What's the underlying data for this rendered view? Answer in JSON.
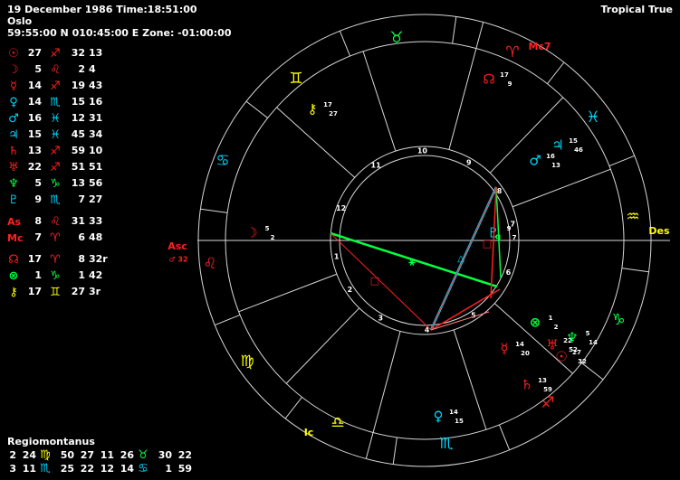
{
  "header": {
    "date_time": "19 December 1986 Time:18:51:00",
    "place": "Oslo",
    "coords": "59:55:00 N 010:45:00 E Zone: -01:00:00",
    "system": "Tropical True"
  },
  "planets": [
    {
      "icon": "sun-icon",
      "glyph": "☉",
      "color": "#ff2020",
      "deg": "27",
      "sign_icon": "sagittarius-icon",
      "sign": "♐",
      "sign_color": "#ff2020",
      "min": "32",
      "sec": "13"
    },
    {
      "icon": "moon-icon",
      "glyph": "☽",
      "color": "#ff2020",
      "deg": "5",
      "sign_icon": "leo-icon",
      "sign": "♌",
      "sign_color": "#ff2020",
      "min": "2",
      "sec": "4"
    },
    {
      "icon": "mercury-icon",
      "glyph": "☿",
      "color": "#ff2020",
      "deg": "14",
      "sign_icon": "sagittarius-icon",
      "sign": "♐",
      "sign_color": "#ff2020",
      "min": "19",
      "sec": "43"
    },
    {
      "icon": "venus-icon",
      "glyph": "♀",
      "color": "#00d8ff",
      "deg": "14",
      "sign_icon": "scorpio-icon",
      "sign": "♏",
      "sign_color": "#00d8ff",
      "min": "15",
      "sec": "16"
    },
    {
      "icon": "mars-icon",
      "glyph": "♂",
      "color": "#00d8ff",
      "deg": "16",
      "sign_icon": "pisces-icon",
      "sign": "♓",
      "sign_color": "#00d8ff",
      "min": "12",
      "sec": "31"
    },
    {
      "icon": "jupiter-icon",
      "glyph": "♃",
      "color": "#00d8ff",
      "deg": "15",
      "sign_icon": "pisces-icon",
      "sign": "♓",
      "sign_color": "#00d8ff",
      "min": "45",
      "sec": "34"
    },
    {
      "icon": "saturn-icon",
      "glyph": "♄",
      "color": "#ff2020",
      "deg": "13",
      "sign_icon": "sagittarius-icon",
      "sign": "♐",
      "sign_color": "#ff2020",
      "min": "59",
      "sec": "10"
    },
    {
      "icon": "uranus-icon",
      "glyph": "♅",
      "color": "#ff2020",
      "deg": "22",
      "sign_icon": "sagittarius-icon",
      "sign": "♐",
      "sign_color": "#ff2020",
      "min": "51",
      "sec": "51"
    },
    {
      "icon": "neptune-icon",
      "glyph": "♆",
      "color": "#00ff40",
      "deg": "5",
      "sign_icon": "capricorn-icon",
      "sign": "♑",
      "sign_color": "#00ff40",
      "min": "13",
      "sec": "56"
    },
    {
      "icon": "pluto-icon",
      "glyph": "♇",
      "color": "#00d8ff",
      "deg": "9",
      "sign_icon": "scorpio-icon",
      "sign": "♏",
      "sign_color": "#00d8ff",
      "min": "7",
      "sec": "27"
    }
  ],
  "angles": [
    {
      "label": "As",
      "color": "#ff2020",
      "deg": "8",
      "sign_icon": "leo-icon",
      "sign": "♌",
      "sign_color": "#ff2020",
      "min": "31",
      "sec": "33"
    },
    {
      "label": "Mc",
      "color": "#ff2020",
      "deg": "7",
      "sign_icon": "aries-icon",
      "sign": "♈",
      "sign_color": "#ff2020",
      "min": "6",
      "sec": "48"
    }
  ],
  "points": [
    {
      "icon": "north-node-icon",
      "glyph": "☊",
      "color": "#ff2020",
      "deg": "17",
      "sign_icon": "aries-icon",
      "sign": "♈",
      "sign_color": "#ff2020",
      "min": "8",
      "sec": "32r"
    },
    {
      "icon": "part-of-fortune-icon",
      "glyph": "⊗",
      "color": "#00ff40",
      "deg": "1",
      "sign_icon": "capricorn-icon",
      "sign": "♑",
      "sign_color": "#00ff40",
      "min": "1",
      "sec": "42"
    },
    {
      "icon": "chiron-icon",
      "glyph": "⚷",
      "color": "#ffff00",
      "deg": "17",
      "sign_icon": "gemini-icon",
      "sign": "♊",
      "sign_color": "#ffff00",
      "min": "27",
      "sec": "3r"
    }
  ],
  "houses": {
    "title": "Regiomontanus",
    "rows": [
      {
        "h1": "2",
        "v1": "24",
        "s1": "♍",
        "s1_icon": "virgo-icon",
        "s1_color": "#ffff00",
        "h2": "50",
        "v2": "27",
        "v3": "11",
        "h3": "26",
        "s2": "♉",
        "s2_icon": "taurus-icon",
        "s2_color": "#00ff40",
        "v4": "30",
        "v5": "22"
      },
      {
        "h1": "3",
        "v1": "11",
        "s1": "♏",
        "s1_icon": "scorpio-icon",
        "s1_color": "#00d8ff",
        "h2": "25",
        "v2": "22",
        "v3": "12",
        "h3": "14",
        "s2": "♋",
        "s2_icon": "cancer-icon",
        "s2_color": "#00d8ff",
        "v4": "1",
        "v5": "59"
      }
    ]
  },
  "wheel": {
    "asc_label": "Asc",
    "des_label": "Des",
    "mc_label": "Mc7",
    "ic_label": "Ic",
    "asc_sub": "♂ 32",
    "mc_deg": "7",
    "house_numbers": [
      "1",
      "2",
      "3",
      "4",
      "5",
      "6",
      "7",
      "8",
      "9",
      "10",
      "11",
      "12"
    ],
    "signs": [
      {
        "icon": "taurus-icon",
        "glyph": "♉",
        "color": "#00ff40"
      },
      {
        "icon": "gemini-icon",
        "glyph": "♊",
        "color": "#ffff00"
      },
      {
        "icon": "cancer-icon",
        "glyph": "♋",
        "color": "#00d8ff"
      },
      {
        "icon": "leo-icon",
        "glyph": "♌",
        "color": "#ff2020"
      },
      {
        "icon": "virgo-icon",
        "glyph": "♍",
        "color": "#ffff00"
      },
      {
        "icon": "libra-icon",
        "glyph": "♎",
        "color": "#ffff00"
      },
      {
        "icon": "scorpio-icon",
        "glyph": "♏",
        "color": "#00d8ff"
      },
      {
        "icon": "sagittarius-icon",
        "glyph": "♐",
        "color": "#ff2020"
      },
      {
        "icon": "capricorn-icon",
        "glyph": "♑",
        "color": "#00ff40"
      },
      {
        "icon": "aquarius-icon",
        "glyph": "♒",
        "color": "#ffff00"
      },
      {
        "icon": "pisces-icon",
        "glyph": "♓",
        "color": "#00d8ff"
      },
      {
        "icon": "aries-icon",
        "glyph": "♈",
        "color": "#ff2020"
      }
    ],
    "chart_planets": [
      {
        "icon": "moon-icon",
        "glyph": "☽",
        "color": "#ff2020",
        "deg": "5",
        "min": "2"
      },
      {
        "icon": "north-node-icon",
        "glyph": "☊",
        "color": "#ff2020",
        "deg": "17",
        "min": "9"
      },
      {
        "icon": "chiron-icon",
        "glyph": "⚷",
        "color": "#ffff00",
        "deg": "17",
        "min": "27"
      },
      {
        "icon": "jupiter-icon",
        "glyph": "♃",
        "color": "#00d8ff",
        "deg": "15",
        "min": "46"
      },
      {
        "icon": "mars-icon",
        "glyph": "♂",
        "color": "#00d8ff",
        "deg": "16",
        "min": "13"
      },
      {
        "icon": "pluto-icon",
        "glyph": "♇",
        "color": "#00d8ff",
        "deg": "9",
        "min": "7"
      },
      {
        "icon": "venus-icon",
        "glyph": "♀",
        "color": "#00d8ff",
        "deg": "14",
        "min": "15"
      },
      {
        "icon": "mercury-icon",
        "glyph": "☿",
        "color": "#ff2020",
        "deg": "14",
        "min": "20"
      },
      {
        "icon": "saturn-icon",
        "glyph": "♄",
        "color": "#ff2020",
        "deg": "13",
        "min": "59"
      },
      {
        "icon": "uranus-icon",
        "glyph": "♅",
        "color": "#ff2020",
        "deg": "22",
        "min": "52"
      },
      {
        "icon": "sun-icon",
        "glyph": "☉",
        "color": "#ff2020",
        "deg": "27",
        "min": "32"
      },
      {
        "icon": "neptune-icon",
        "glyph": "♆",
        "color": "#00ff40",
        "deg": "5",
        "min": "14"
      },
      {
        "icon": "part-of-fortune-icon",
        "glyph": "⊗",
        "color": "#00ff40",
        "deg": "1",
        "min": "2"
      }
    ]
  }
}
